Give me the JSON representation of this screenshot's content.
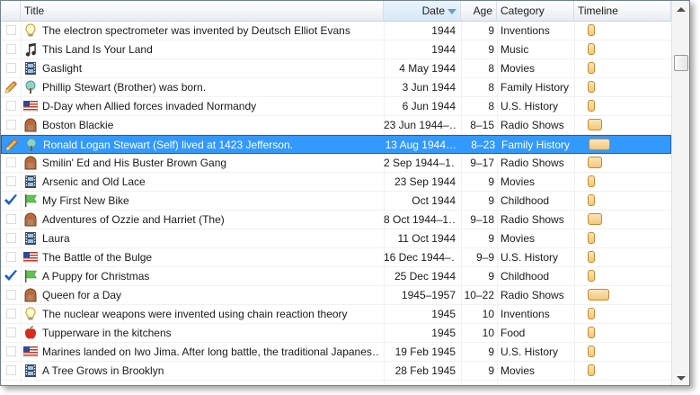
{
  "columns": {
    "title": "Title",
    "date": "Date",
    "age": "Age",
    "category": "Category",
    "timeline": "Timeline"
  },
  "rows": [
    {
      "check": "",
      "icon": "lightbulb-icon",
      "title": "The electron spectrometer was invented by Deutsch Elliot Evans",
      "date": "1944",
      "age": "9",
      "category": "Inventions",
      "bar": "thin"
    },
    {
      "check": "",
      "icon": "music-note-icon",
      "title": "This Land Is Your Land",
      "date": "1944",
      "age": "9",
      "category": "Music",
      "bar": "thin"
    },
    {
      "check": "",
      "icon": "film-icon",
      "title": "Gaslight",
      "date": "4 May 1944",
      "age": "8",
      "category": "Movies",
      "bar": "thin"
    },
    {
      "check": "pencil",
      "icon": "family-tree-icon",
      "title": "Phillip Stewart (Brother) was born.",
      "date": "3 Jun 1944",
      "age": "8",
      "category": "Family History",
      "bar": "thin"
    },
    {
      "check": "",
      "icon": "us-flag-icon",
      "title": "D-Day when Allied forces invaded Normandy",
      "date": "6 Jun 1944",
      "age": "8",
      "category": "U.S. History",
      "bar": "thin"
    },
    {
      "check": "",
      "icon": "radio-icon",
      "title": "Boston Blackie",
      "date": "23 Jun 1944–…",
      "age": "8–15",
      "category": "Radio Shows",
      "bar": "mid"
    },
    {
      "check": "pencil",
      "icon": "family-tree-icon",
      "title": "Ronald Logan Stewart (Self) lived at 1423 Jefferson.",
      "date": "13 Aug 1944…",
      "age": "8–23",
      "category": "Family History",
      "bar": "wide",
      "selected": true
    },
    {
      "check": "",
      "icon": "radio-icon",
      "title": "Smilin' Ed and His Buster Brown Gang",
      "date": "2 Sep 1944–1…",
      "age": "9–17",
      "category": "Radio Shows",
      "bar": "mid"
    },
    {
      "check": "",
      "icon": "film-icon",
      "title": "Arsenic and Old Lace",
      "date": "23 Sep 1944",
      "age": "9",
      "category": "Movies",
      "bar": "thin"
    },
    {
      "check": "checkmark",
      "icon": "green-flag-icon",
      "title": "My First New Bike",
      "date": "Oct 1944",
      "age": "9",
      "category": "Childhood",
      "bar": "thin"
    },
    {
      "check": "",
      "icon": "radio-icon",
      "title": "Adventures of Ozzie and Harriet (The)",
      "date": "8 Oct 1944–1…",
      "age": "9–18",
      "category": "Radio Shows",
      "bar": "mid"
    },
    {
      "check": "",
      "icon": "film-icon",
      "title": "Laura",
      "date": "11 Oct 1944",
      "age": "9",
      "category": "Movies",
      "bar": "thin"
    },
    {
      "check": "",
      "icon": "us-flag-icon",
      "title": "The Battle of the Bulge",
      "date": "16 Dec 1944–…",
      "age": "9–9",
      "category": "U.S. History",
      "bar": "thin"
    },
    {
      "check": "checkmark",
      "icon": "green-flag-icon",
      "title": "A Puppy for Christmas",
      "date": "25 Dec 1944",
      "age": "9",
      "category": "Childhood",
      "bar": "thin"
    },
    {
      "check": "",
      "icon": "radio-icon",
      "title": "Queen for a Day",
      "date": "1945–1957",
      "age": "10–22",
      "category": "Radio Shows",
      "bar": "wide"
    },
    {
      "check": "",
      "icon": "lightbulb-icon",
      "title": "The nuclear weapons were invented using chain reaction theory",
      "date": "1945",
      "age": "10",
      "category": "Inventions",
      "bar": "thin"
    },
    {
      "check": "",
      "icon": "apple-icon",
      "title": "Tupperware in the kitchens",
      "date": "1945",
      "age": "10",
      "category": "Food",
      "bar": "thin"
    },
    {
      "check": "",
      "icon": "us-flag-icon",
      "title": "Marines landed on Iwo Jima. After long battle, the traditional Japanes…",
      "date": "19 Feb 1945",
      "age": "9",
      "category": "U.S. History",
      "bar": "thin"
    },
    {
      "check": "",
      "icon": "film-icon",
      "title": "A Tree Grows in Brooklyn",
      "date": "28 Feb 1945",
      "age": "9",
      "category": "Movies",
      "bar": "thin"
    }
  ]
}
